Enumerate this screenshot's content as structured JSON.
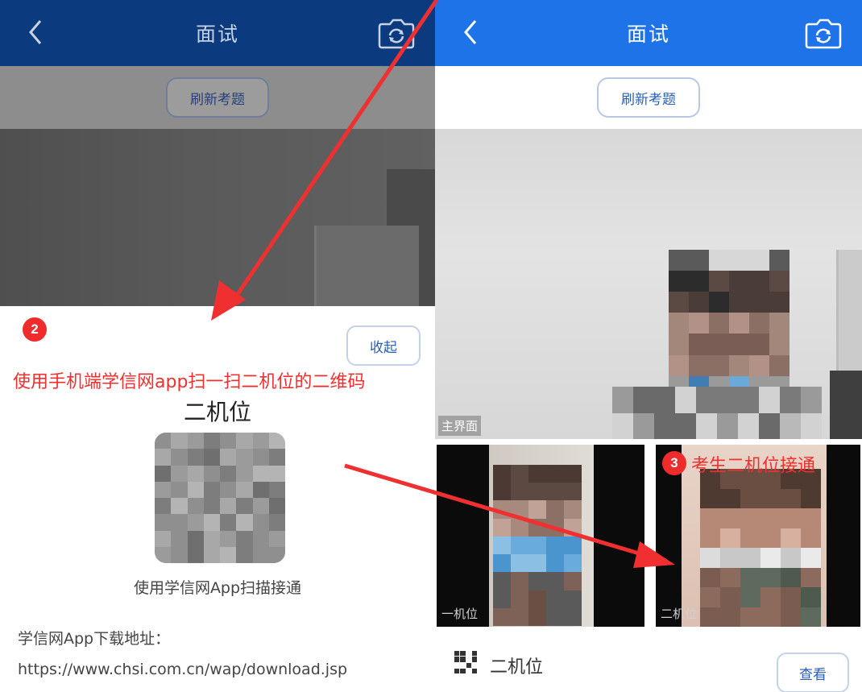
{
  "left": {
    "header": {
      "title": "面试"
    },
    "refresh_label": "刷新考题",
    "step_badge": "2",
    "collapse_label": "收起",
    "instruction": "使用手机端学信网app扫一扫二机位的二维码",
    "seat_title": "二机位",
    "scan_text": "使用学信网App扫描接通",
    "download_label": "学信网App下载地址：",
    "download_url": "https://www.chsi.com.cn/wap/download.jsp"
  },
  "right": {
    "header": {
      "title": "面试"
    },
    "refresh_label": "刷新考题",
    "main_video_label": "主界面",
    "step_badge": "3",
    "connected_note": "考生二机位接通",
    "thumb1_label": "一机位",
    "thumb2_label": "二机位",
    "seat_row_label": "二机位",
    "view_label": "查看"
  },
  "icons": {
    "back": "chevron-left-icon",
    "camera_switch": "camera-switch-icon",
    "qr": "qr-code-icon"
  },
  "colors": {
    "header_dark": "#0b3a7e",
    "header_blue": "#1f73e8",
    "accent_red": "#ef2b2b",
    "button_text": "#2a5fb4"
  }
}
